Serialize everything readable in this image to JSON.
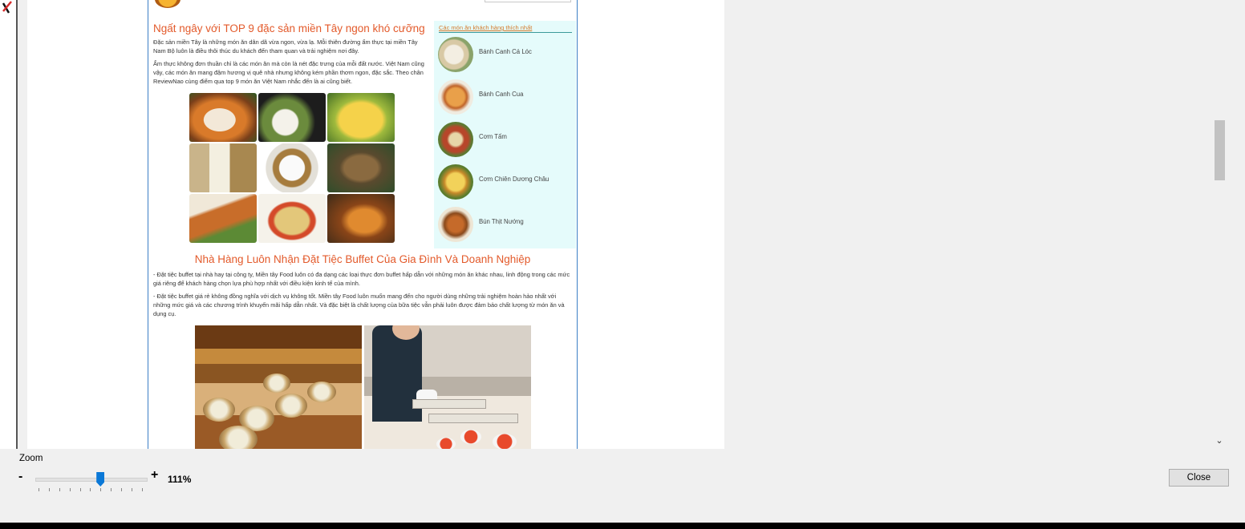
{
  "article": {
    "title": "Ngất ngây với TOP 9 đặc sản miền Tây ngon khó cưỡng",
    "para1": "Đặc sản miền Tây là những món ăn dân dã vừa ngon, vừa lạ. Mỗi thiên đường ẩm thực tại miền Tây Nam Bộ luôn là điều thôi thúc du khách đến tham quan và trải nghiệm nơi đây.",
    "para2": "Ẩm thực không đơn thuần chỉ là các món ăn mà còn là nét đặc trưng của mỗi đất nước. Việt Nam cũng vậy, các món ăn mang đậm hương vị quê nhà nhưng không kém phần thơm ngon, đặc sắc. Theo chân ReviewNao cùng điểm qua top 9 món ăn Việt Nam nhắc đến là ai cũng biết."
  },
  "sidebar": {
    "heading": "Các món ăn khách hàng thích nhất",
    "items": [
      {
        "label": "Bánh Canh Cá Lóc"
      },
      {
        "label": "Bánh Canh Cua"
      },
      {
        "label": "Cơm Tấm"
      },
      {
        "label": "Cơm Chiên Dương Châu"
      },
      {
        "label": "Bún Thịt Nướng"
      }
    ]
  },
  "section2": {
    "title": "Nhà Hàng Luôn Nhận Đặt Tiệc Buffet Của Gia Đình Và Doanh Nghiệp",
    "para1": "- Đặt tiệc buffet tại nhà hay tại công ty, Miền tây Food luôn có đa dạng các loại thực đơn buffet hấp dẫn với những món ăn khác nhau, linh động trong các mức giá riêng để khách hàng chọn lựa phù hợp nhất với điều kiện kinh tế của mình.",
    "para2": "- Đặt tiệc buffet giá rẻ không đồng nghĩa với dịch vụ không tốt. Miền tây Food luôn muốn mang đến cho người dùng những trải nghiệm hoàn hảo nhất với những mức giá và các chương trình khuyến mãi hấp dẫn nhất. Và đặc biệt là chất lượng của bữa tiệc vẫn phải luôn được đảm bảo chất lượng từ món ăn và dụng cụ."
  },
  "zoom": {
    "label": "Zoom",
    "minus": "-",
    "plus": "+",
    "value_text": "111%",
    "slider_fraction": 0.58
  },
  "dialog": {
    "close_label": "Close"
  },
  "icons": {
    "scroll_down": "scroll-down-arrow-icon",
    "logo": "site-logo-icon"
  },
  "colors": {
    "accent_orange": "#e35a2b",
    "frame_blue": "#3c7fc6",
    "slider_blue": "#0a78d7",
    "sidebar_bg": "#e5fbfb"
  }
}
